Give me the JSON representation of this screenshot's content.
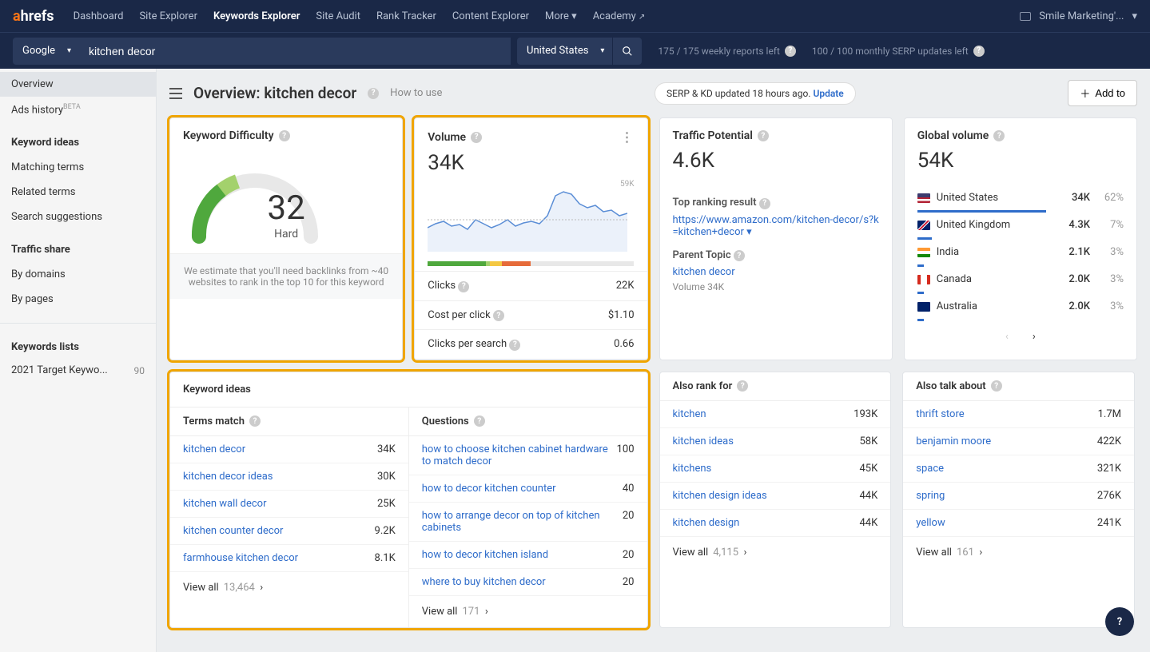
{
  "topnav": {
    "links": [
      "Dashboard",
      "Site Explorer",
      "Keywords Explorer",
      "Site Audit",
      "Rank Tracker",
      "Content Explorer",
      "More"
    ],
    "activeIndex": 2,
    "academy": "Academy",
    "account": "Smile Marketing'..."
  },
  "searchbar": {
    "source": "Google",
    "keyword": "kitchen decor",
    "country": "United States",
    "usage_weekly": "175 / 175 weekly reports left",
    "usage_monthly": "100 / 100 monthly SERP updates left"
  },
  "header": {
    "title": "Overview: kitchen decor",
    "how_to": "How to use",
    "serp_note": "SERP & KD updated 18 hours ago.",
    "update": "Update",
    "add_to": "Add to"
  },
  "sidebar": {
    "overview": "Overview",
    "ads": "Ads history",
    "ideas_head": "Keyword ideas",
    "matching": "Matching terms",
    "related": "Related terms",
    "suggestions": "Search suggestions",
    "traffic_head": "Traffic share",
    "by_domains": "By domains",
    "by_pages": "By pages",
    "lists_head": "Keywords lists",
    "list1": "2021 Target Keywo...",
    "list1_count": "90"
  },
  "kd": {
    "title": "Keyword Difficulty",
    "value": "32",
    "label": "Hard",
    "note": "We estimate that you'll need backlinks from ~40 websites to rank in the top 10 for this keyword"
  },
  "volume": {
    "title": "Volume",
    "value": "34K",
    "peak": "59K",
    "clicks_lbl": "Clicks",
    "clicks_val": "22K",
    "cpc_lbl": "Cost per click",
    "cpc_val": "$1.10",
    "cps_lbl": "Clicks per search",
    "cps_val": "0.66"
  },
  "tp": {
    "title": "Traffic Potential",
    "value": "4.6K",
    "top_lbl": "Top ranking result",
    "top_url": "https://www.amazon.com/kitchen-decor/s?k=kitchen+decor",
    "parent_lbl": "Parent Topic",
    "parent_kw": "kitchen decor",
    "parent_vol": "Volume 34K"
  },
  "gv": {
    "title": "Global volume",
    "value": "54K",
    "rows": [
      {
        "country": "United States",
        "vol": "34K",
        "pct": "62%",
        "flag": "us"
      },
      {
        "country": "United Kingdom",
        "vol": "4.3K",
        "pct": "7%",
        "flag": "gb"
      },
      {
        "country": "India",
        "vol": "2.1K",
        "pct": "3%",
        "flag": "in"
      },
      {
        "country": "Canada",
        "vol": "2.0K",
        "pct": "3%",
        "flag": "ca"
      },
      {
        "country": "Australia",
        "vol": "2.0K",
        "pct": "3%",
        "flag": "au"
      }
    ]
  },
  "ideas": {
    "title": "Keyword ideas",
    "terms_head": "Terms match",
    "questions_head": "Questions",
    "terms": [
      {
        "kw": "kitchen decor",
        "v": "34K"
      },
      {
        "kw": "kitchen decor ideas",
        "v": "30K"
      },
      {
        "kw": "kitchen wall decor",
        "v": "25K"
      },
      {
        "kw": "kitchen counter decor",
        "v": "9.2K"
      },
      {
        "kw": "farmhouse kitchen decor",
        "v": "8.1K"
      }
    ],
    "terms_viewall": "View all",
    "terms_count": "13,464",
    "questions": [
      {
        "kw": "how to choose kitchen cabinet hardware to match decor",
        "v": "100"
      },
      {
        "kw": "how to decor kitchen counter",
        "v": "40"
      },
      {
        "kw": "how to arrange decor on top of kitchen cabinets",
        "v": "20"
      },
      {
        "kw": "how to decor kitchen island",
        "v": "20"
      },
      {
        "kw": "where to buy kitchen decor",
        "v": "20"
      }
    ],
    "questions_viewall": "View all",
    "questions_count": "171"
  },
  "also_rank": {
    "head": "Also rank for",
    "rows": [
      {
        "kw": "kitchen",
        "v": "193K"
      },
      {
        "kw": "kitchen ideas",
        "v": "58K"
      },
      {
        "kw": "kitchens",
        "v": "45K"
      },
      {
        "kw": "kitchen design ideas",
        "v": "44K"
      },
      {
        "kw": "kitchen design",
        "v": "44K"
      }
    ],
    "viewall": "View all",
    "count": "4,115"
  },
  "also_talk": {
    "head": "Also talk about",
    "rows": [
      {
        "kw": "thrift store",
        "v": "1.7M"
      },
      {
        "kw": "benjamin moore",
        "v": "422K"
      },
      {
        "kw": "space",
        "v": "321K"
      },
      {
        "kw": "spring",
        "v": "276K"
      },
      {
        "kw": "yellow",
        "v": "241K"
      }
    ],
    "viewall": "View all",
    "count": "161"
  },
  "chart_data": {
    "type": "line",
    "title": "Volume trend",
    "ylim": [
      0,
      59000
    ],
    "y": [
      28000,
      30000,
      31000,
      27000,
      29000,
      26000,
      33000,
      30000,
      27000,
      29000,
      32000,
      28000,
      30000,
      31000,
      29000,
      34000,
      48000,
      51000,
      49000,
      42000,
      38000,
      40000,
      36000,
      37000,
      33000,
      39000,
      35000,
      32000,
      34000
    ]
  }
}
